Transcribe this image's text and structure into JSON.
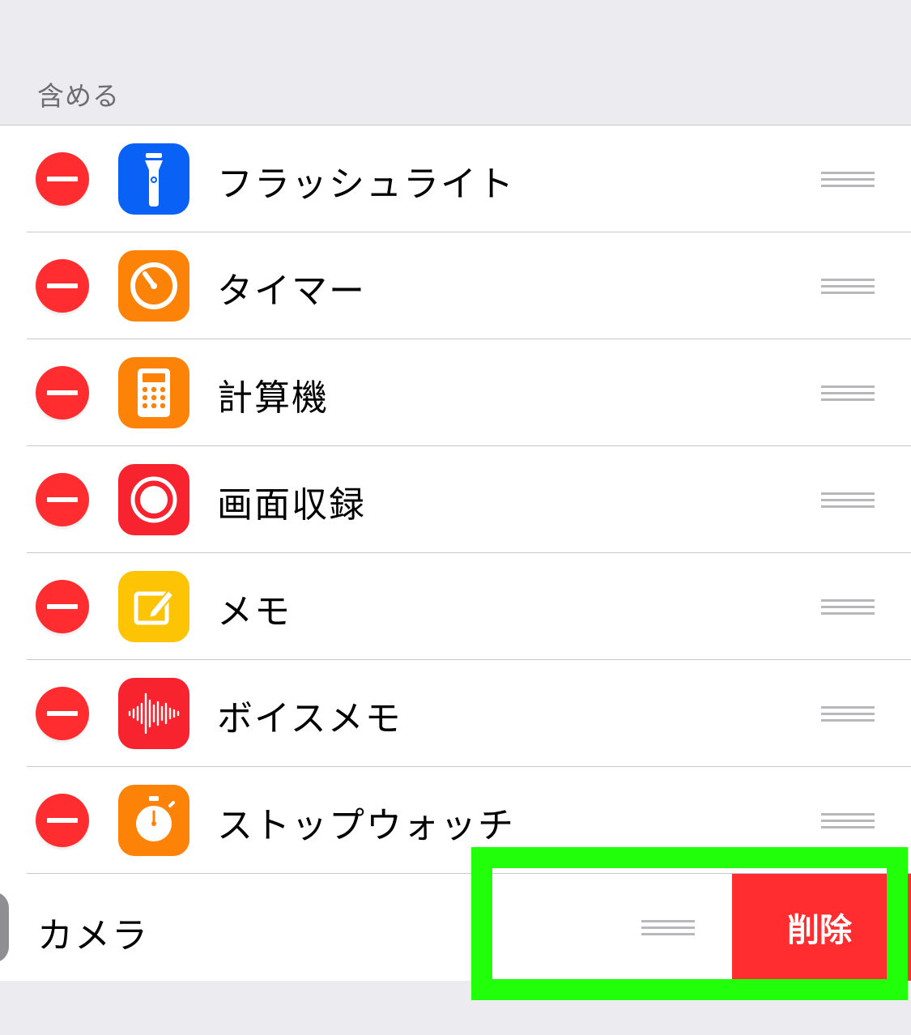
{
  "section": {
    "header": "含める"
  },
  "items": [
    {
      "label": "フラッシュライト",
      "icon": "flashlight-icon",
      "icon_color": "#0A61F5"
    },
    {
      "label": "タイマー",
      "icon": "timer-icon",
      "icon_color": "#FD8208"
    },
    {
      "label": "計算機",
      "icon": "calculator-icon",
      "icon_color": "#FD8208"
    },
    {
      "label": "画面収録",
      "icon": "screen-recording-icon",
      "icon_color": "#F7232F"
    },
    {
      "label": "メモ",
      "icon": "notes-icon",
      "icon_color": "#FDC405"
    },
    {
      "label": "ボイスメモ",
      "icon": "voice-memos-icon",
      "icon_color": "#F7232F"
    },
    {
      "label": "ストップウォッチ",
      "icon": "stopwatch-icon",
      "icon_color": "#FD8208"
    }
  ],
  "swiped_item": {
    "label": "カメラ",
    "icon": "camera-icon",
    "icon_color": "#8E8E93"
  },
  "delete_action": {
    "label": "削除",
    "color": "#FF2D2F"
  },
  "colors": {
    "background": "#EBEBF0",
    "remove_button": "#FF2D2F",
    "highlight": "#22FF0B"
  }
}
